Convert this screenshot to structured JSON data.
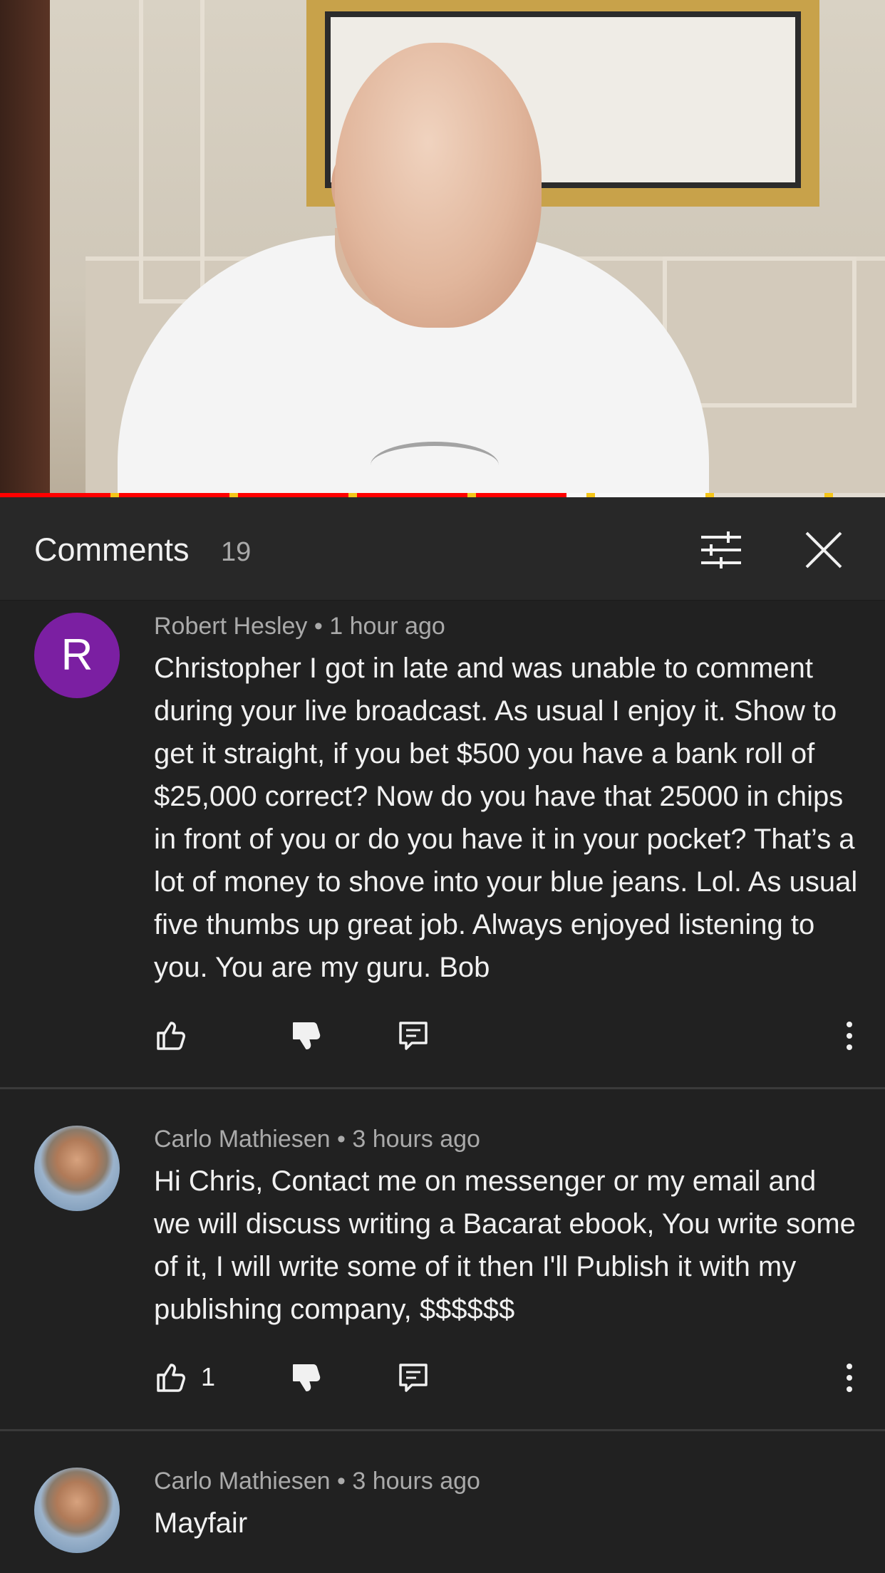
{
  "video": {
    "progress_fraction": 0.64
  },
  "header": {
    "title": "Comments",
    "count": "19"
  },
  "comments": [
    {
      "avatar_letter": "R",
      "avatar_color": "#7b1fa2",
      "author": "Robert Hesley",
      "time": "1 hour ago",
      "text": "Christopher I got in late and was unable to comment during your live broadcast. As usual I enjoy it. Show to get it straight, if you bet $500 you have a bank roll of $25,000 correct? Now do you have that 25000 in chips in front of you or do you have it in your pocket? That’s a lot of money to shove into your blue jeans. Lol.   As usual five thumbs up great job. Always enjoyed listening to you. You are my guru. Bob",
      "likes": ""
    },
    {
      "author": "Carlo Mathiesen",
      "time": "3 hours ago",
      "text": "Hi Chris, Contact me on messenger or my email and we will discuss writing a Bacarat ebook, You write some of it, I will write some of it then I'll Publish it with my publishing company, $$$$$$",
      "likes": "1"
    },
    {
      "author": "Carlo Mathiesen",
      "time": "3 hours ago",
      "text": "Mayfair",
      "likes": ""
    }
  ],
  "meta_separator": " • ",
  "icons": [
    "filter-icon",
    "close-icon",
    "thumb-up-icon",
    "thumb-down-icon",
    "reply-icon",
    "more-vert-icon"
  ]
}
